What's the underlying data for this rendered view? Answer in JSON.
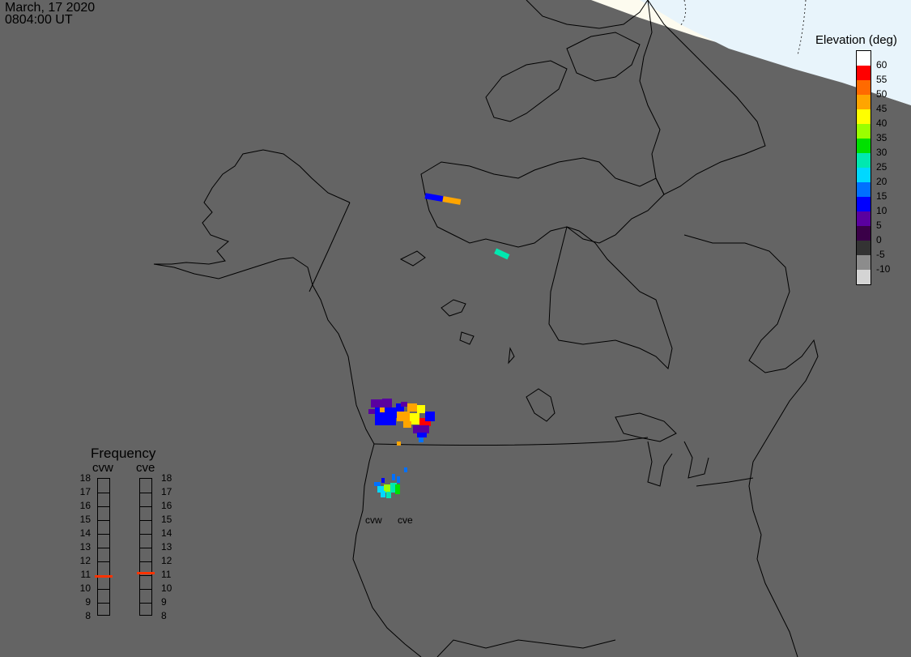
{
  "header": {
    "date": "March, 17 2020",
    "time": "0804:00 UT"
  },
  "legend": {
    "title": "Elevation (deg)",
    "entries": [
      {
        "label": "60",
        "color": "#ffffff"
      },
      {
        "label": "55",
        "color": "#ff0000"
      },
      {
        "label": "50",
        "color": "#ff6a00"
      },
      {
        "label": "45",
        "color": "#ffa500"
      },
      {
        "label": "40",
        "color": "#ffff00"
      },
      {
        "label": "35",
        "color": "#9aff00"
      },
      {
        "label": "30",
        "color": "#00e000"
      },
      {
        "label": "25",
        "color": "#00e8b0"
      },
      {
        "label": "20",
        "color": "#00d8ff"
      },
      {
        "label": "15",
        "color": "#0070ff"
      },
      {
        "label": "10",
        "color": "#0000ff"
      },
      {
        "label": "5",
        "color": "#5a00a0"
      },
      {
        "label": "0",
        "color": "#3a0048"
      },
      {
        "label": "-5",
        "color": "#333333"
      },
      {
        "label": "-10",
        "color": "#8c8c8c"
      },
      {
        "label": "",
        "color": "#d4d4d4"
      }
    ]
  },
  "frequency": {
    "title": "Frequency",
    "radars": [
      {
        "name": "cvw",
        "level": 10.9
      },
      {
        "name": "cve",
        "level": 11.1
      }
    ],
    "scale": [
      "18",
      "17",
      "16",
      "15",
      "14",
      "13",
      "12",
      "11",
      "10",
      "9",
      "8"
    ],
    "indicator_color": "#ff3300"
  },
  "sites": {
    "west": "cvw",
    "east": "cve"
  }
}
